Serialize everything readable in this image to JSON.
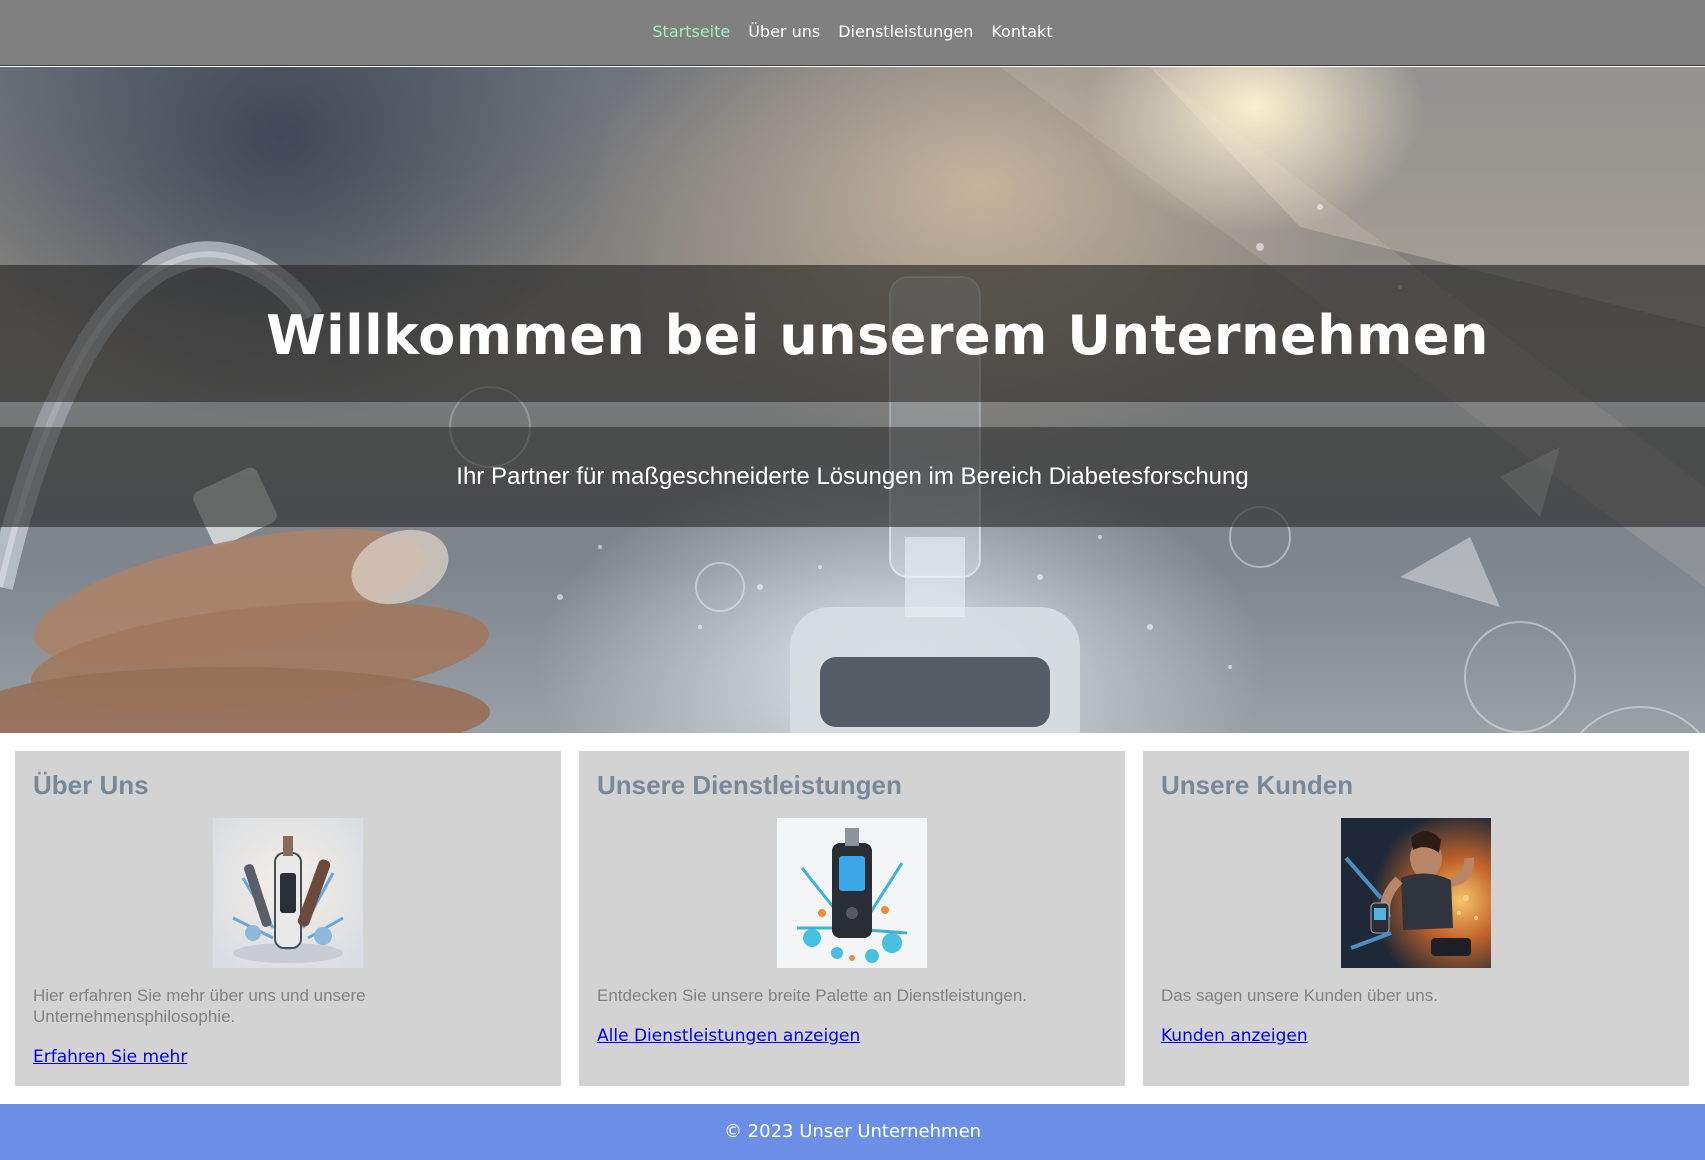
{
  "nav": {
    "items": [
      {
        "label": "Startseite",
        "active": true
      },
      {
        "label": "Über uns",
        "active": false
      },
      {
        "label": "Dienstleistungen",
        "active": false
      },
      {
        "label": "Kontakt",
        "active": false
      }
    ],
    "active_color": "#9cf0c6",
    "background": "#808080"
  },
  "hero": {
    "title": "Willkommen bei unserem Unternehmen",
    "subtitle": "Ihr Partner für maßgeschneiderte Lösungen im Bereich Diabetesforschung",
    "image_icon": "diabetes-device-hero-image"
  },
  "cards": [
    {
      "title": "Über Uns",
      "image_icon": "insulin-pen-image",
      "text": "Hier erfahren Sie mehr über uns und unsere Unternehmensphilosophie.",
      "link": "Erfahren Sie mehr"
    },
    {
      "title": "Unsere Dienstleistungen",
      "image_icon": "glucose-meter-image",
      "text": "Entdecken Sie unsere breite Palette an Dienstleistungen.",
      "link": "Alle Dienstleistungen anzeigen"
    },
    {
      "title": "Unsere Kunden",
      "image_icon": "athlete-with-device-image",
      "text": "Das sagen unsere Kunden über uns.",
      "link": "Kunden anzeigen"
    }
  ],
  "footer": {
    "text": "© 2023 Unser Unternehmen",
    "background": "#6b8fe6"
  },
  "colors": {
    "card_background": "#d3d3d3",
    "card_title": "#778899",
    "link": "#0000ee"
  }
}
